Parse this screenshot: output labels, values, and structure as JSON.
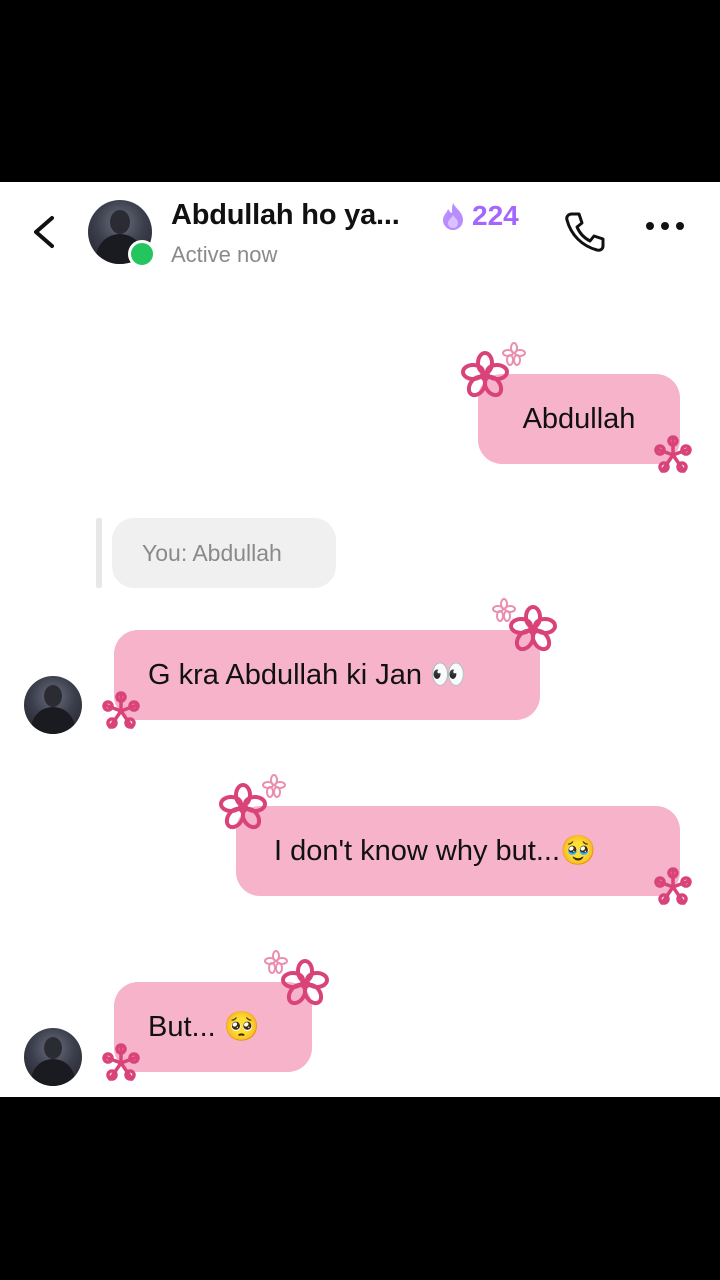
{
  "header": {
    "back_icon": "chevron-left-icon",
    "contact_name": "Abdullah ho ya...",
    "status": "Active now",
    "streak_icon": "fire-icon",
    "streak_count": "224",
    "call_icon": "phone-icon",
    "more_icon": "more-horizontal-icon"
  },
  "messages": [
    {
      "from": "me",
      "text": "Abdullah"
    },
    {
      "from": "reply-preview",
      "text": "You: Abdullah"
    },
    {
      "from": "them",
      "text": "G kra Abdullah ki Jan 👀"
    },
    {
      "from": "me",
      "text": "I don't know why but...🥹"
    },
    {
      "from": "them",
      "text": "But... 🥺"
    }
  ],
  "colors": {
    "bubble": "#f7b3c9",
    "flower": "#d9437a",
    "online": "#22c55e",
    "streak": "#a366ff"
  }
}
